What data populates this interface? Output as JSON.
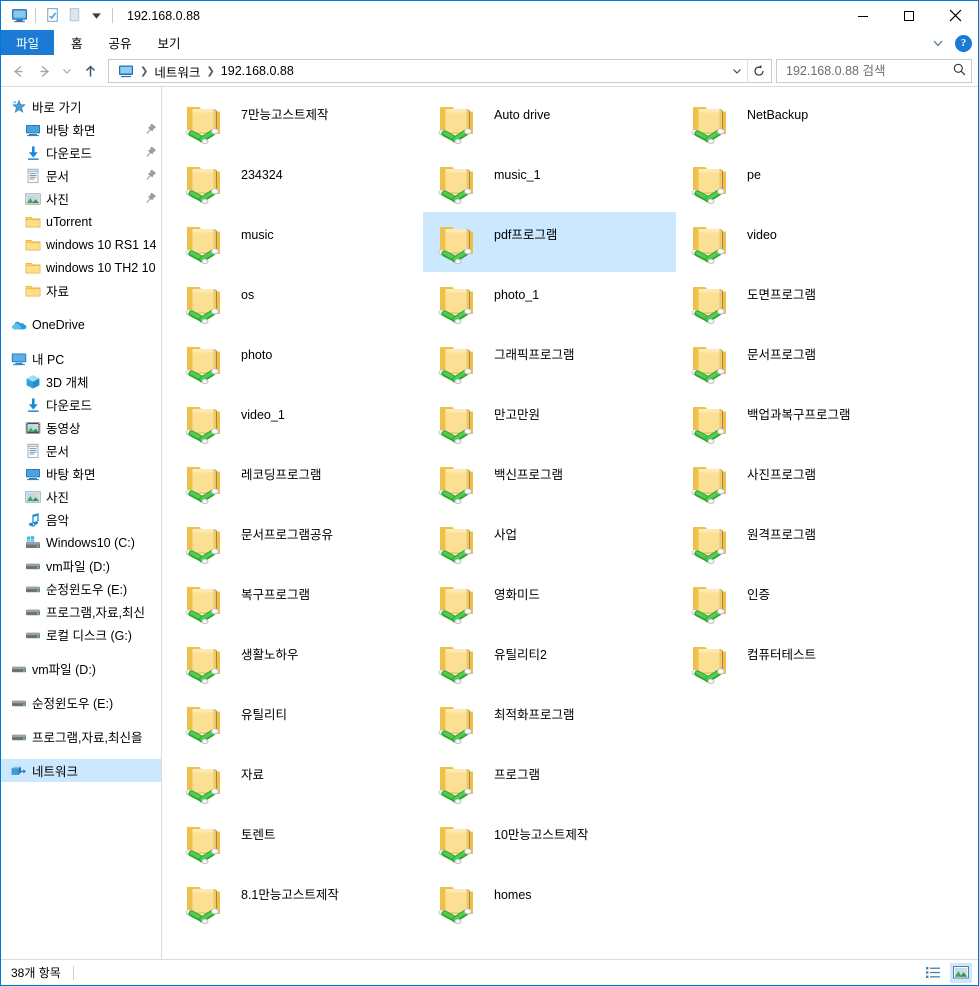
{
  "window": {
    "title": "192.168.0.88",
    "quick_access": [
      "computer-icon",
      "properties-icon",
      "new-folder-icon",
      "customize-dropdown-icon"
    ],
    "controls": {
      "minimize": "—",
      "maximize": "☐",
      "close": "✕"
    }
  },
  "ribbon": {
    "tabs": [
      {
        "label": "파일",
        "active_file": true
      },
      {
        "label": "홈",
        "active_file": false
      },
      {
        "label": "공유",
        "active_file": false
      },
      {
        "label": "보기",
        "active_file": false
      }
    ],
    "expand_icon": "chevron-down-icon",
    "help_label": "?"
  },
  "address": {
    "back": "←",
    "forward": "→",
    "recent": "⌄",
    "up": "↑",
    "root_icon": "network-computer-icon",
    "crumbs": [
      "네트워크",
      "192.168.0.88"
    ],
    "dropdown": "⌄",
    "refresh": "↻"
  },
  "search": {
    "placeholder": "192.168.0.88 검색",
    "value": "",
    "icon": "search-icon"
  },
  "sidebar": {
    "items": [
      {
        "label": "바로 가기",
        "icon": "star-quick-access-icon",
        "level": 0,
        "pin": false,
        "selected": false
      },
      {
        "label": "바탕 화면",
        "icon": "desktop-icon",
        "level": 1,
        "pin": true,
        "selected": false
      },
      {
        "label": "다운로드",
        "icon": "download-icon",
        "level": 1,
        "pin": true,
        "selected": false
      },
      {
        "label": "문서",
        "icon": "documents-icon",
        "level": 1,
        "pin": true,
        "selected": false
      },
      {
        "label": "사진",
        "icon": "pictures-icon",
        "level": 1,
        "pin": true,
        "selected": false
      },
      {
        "label": "uTorrent",
        "icon": "folder-icon",
        "level": 1,
        "pin": false,
        "selected": false
      },
      {
        "label": "windows 10 RS1 14",
        "icon": "folder-icon",
        "level": 1,
        "pin": false,
        "selected": false
      },
      {
        "label": "windows 10 TH2 10",
        "icon": "folder-icon",
        "level": 1,
        "pin": false,
        "selected": false
      },
      {
        "label": "자료",
        "icon": "folder-icon",
        "level": 1,
        "pin": false,
        "selected": false
      },
      {
        "label": "__GAP__",
        "icon": "",
        "level": 0,
        "pin": false,
        "selected": false
      },
      {
        "label": "OneDrive",
        "icon": "onedrive-cloud-icon",
        "level": 0,
        "pin": false,
        "selected": false
      },
      {
        "label": "__GAP__",
        "icon": "",
        "level": 0,
        "pin": false,
        "selected": false
      },
      {
        "label": "내 PC",
        "icon": "this-pc-icon",
        "level": 0,
        "pin": false,
        "selected": false
      },
      {
        "label": "3D 개체",
        "icon": "3d-objects-icon",
        "level": 1,
        "pin": false,
        "selected": false
      },
      {
        "label": "다운로드",
        "icon": "download-icon",
        "level": 1,
        "pin": false,
        "selected": false
      },
      {
        "label": "동영상",
        "icon": "videos-icon",
        "level": 1,
        "pin": false,
        "selected": false
      },
      {
        "label": "문서",
        "icon": "documents-icon",
        "level": 1,
        "pin": false,
        "selected": false
      },
      {
        "label": "바탕 화면",
        "icon": "desktop-icon",
        "level": 1,
        "pin": false,
        "selected": false
      },
      {
        "label": "사진",
        "icon": "pictures-icon",
        "level": 1,
        "pin": false,
        "selected": false
      },
      {
        "label": "음악",
        "icon": "music-note-icon",
        "level": 1,
        "pin": false,
        "selected": false
      },
      {
        "label": "Windows10 (C:)",
        "icon": "windows-drive-icon",
        "level": 1,
        "pin": false,
        "selected": false
      },
      {
        "label": "vm파일 (D:)",
        "icon": "hard-drive-icon",
        "level": 1,
        "pin": false,
        "selected": false
      },
      {
        "label": "순정윈도우 (E:)",
        "icon": "hard-drive-icon",
        "level": 1,
        "pin": false,
        "selected": false
      },
      {
        "label": "프로그램,자료,최신",
        "icon": "hard-drive-icon",
        "level": 1,
        "pin": false,
        "selected": false
      },
      {
        "label": "로컬 디스크 (G:)",
        "icon": "hard-drive-icon",
        "level": 1,
        "pin": false,
        "selected": false
      },
      {
        "label": "__GAP__",
        "icon": "",
        "level": 0,
        "pin": false,
        "selected": false
      },
      {
        "label": "vm파일 (D:)",
        "icon": "hard-drive-icon",
        "level": 0,
        "pin": false,
        "selected": false
      },
      {
        "label": "__GAP__",
        "icon": "",
        "level": 0,
        "pin": false,
        "selected": false
      },
      {
        "label": "순정윈도우 (E:)",
        "icon": "hard-drive-icon",
        "level": 0,
        "pin": false,
        "selected": false
      },
      {
        "label": "__GAP__",
        "icon": "",
        "level": 0,
        "pin": false,
        "selected": false
      },
      {
        "label": "프로그램,자료,최신을",
        "icon": "hard-drive-icon",
        "level": 0,
        "pin": false,
        "selected": false
      },
      {
        "label": "__GAP__",
        "icon": "",
        "level": 0,
        "pin": false,
        "selected": false
      },
      {
        "label": "네트워크",
        "icon": "network-share-icon",
        "level": 0,
        "pin": false,
        "selected": true
      }
    ]
  },
  "files": {
    "icon": "network-shared-folder-icon",
    "items": [
      {
        "name": "7만능고스트제작",
        "selected": false
      },
      {
        "name": "234324",
        "selected": false
      },
      {
        "name": "music",
        "selected": false
      },
      {
        "name": "os",
        "selected": false
      },
      {
        "name": "photo",
        "selected": false
      },
      {
        "name": "video_1",
        "selected": false
      },
      {
        "name": "레코딩프로그램",
        "selected": false
      },
      {
        "name": "문서프로그램공유",
        "selected": false
      },
      {
        "name": "복구프로그램",
        "selected": false
      },
      {
        "name": "생활노하우",
        "selected": false
      },
      {
        "name": "유틸리티",
        "selected": false
      },
      {
        "name": "자료",
        "selected": false
      },
      {
        "name": "토렌트",
        "selected": false
      },
      {
        "name": "8.1만능고스트제작",
        "selected": false
      },
      {
        "name": "Auto drive",
        "selected": false
      },
      {
        "name": "music_1",
        "selected": false
      },
      {
        "name": "pdf프로그램",
        "selected": true
      },
      {
        "name": "photo_1",
        "selected": false
      },
      {
        "name": "그래픽프로그램",
        "selected": false
      },
      {
        "name": "만고만원",
        "selected": false
      },
      {
        "name": "백신프로그램",
        "selected": false
      },
      {
        "name": "사업",
        "selected": false
      },
      {
        "name": "영화미드",
        "selected": false
      },
      {
        "name": "유틸리티2",
        "selected": false
      },
      {
        "name": "최적화프로그램",
        "selected": false
      },
      {
        "name": "프로그램",
        "selected": false
      },
      {
        "name": "10만능고스트제작",
        "selected": false
      },
      {
        "name": "homes",
        "selected": false
      },
      {
        "name": "NetBackup",
        "selected": false
      },
      {
        "name": "pe",
        "selected": false
      },
      {
        "name": "video",
        "selected": false
      },
      {
        "name": "도면프로그램",
        "selected": false
      },
      {
        "name": "문서프로그램",
        "selected": false
      },
      {
        "name": "백업과복구프로그램",
        "selected": false
      },
      {
        "name": "사진프로그램",
        "selected": false
      },
      {
        "name": "원격프로그램",
        "selected": false
      },
      {
        "name": "인증",
        "selected": false
      },
      {
        "name": "컴퓨터테스트",
        "selected": false
      }
    ]
  },
  "statusbar": {
    "item_count": "38개 항목",
    "views": [
      {
        "name": "details-view-button",
        "active": false
      },
      {
        "name": "large-icons-view-button",
        "active": true
      }
    ]
  },
  "colors": {
    "accent": "#1a7ad4",
    "selection": "#cce8ff",
    "window_border": "#0078d7",
    "folder_yellow": "#ffd966",
    "network_green": "#3fbf3f"
  }
}
